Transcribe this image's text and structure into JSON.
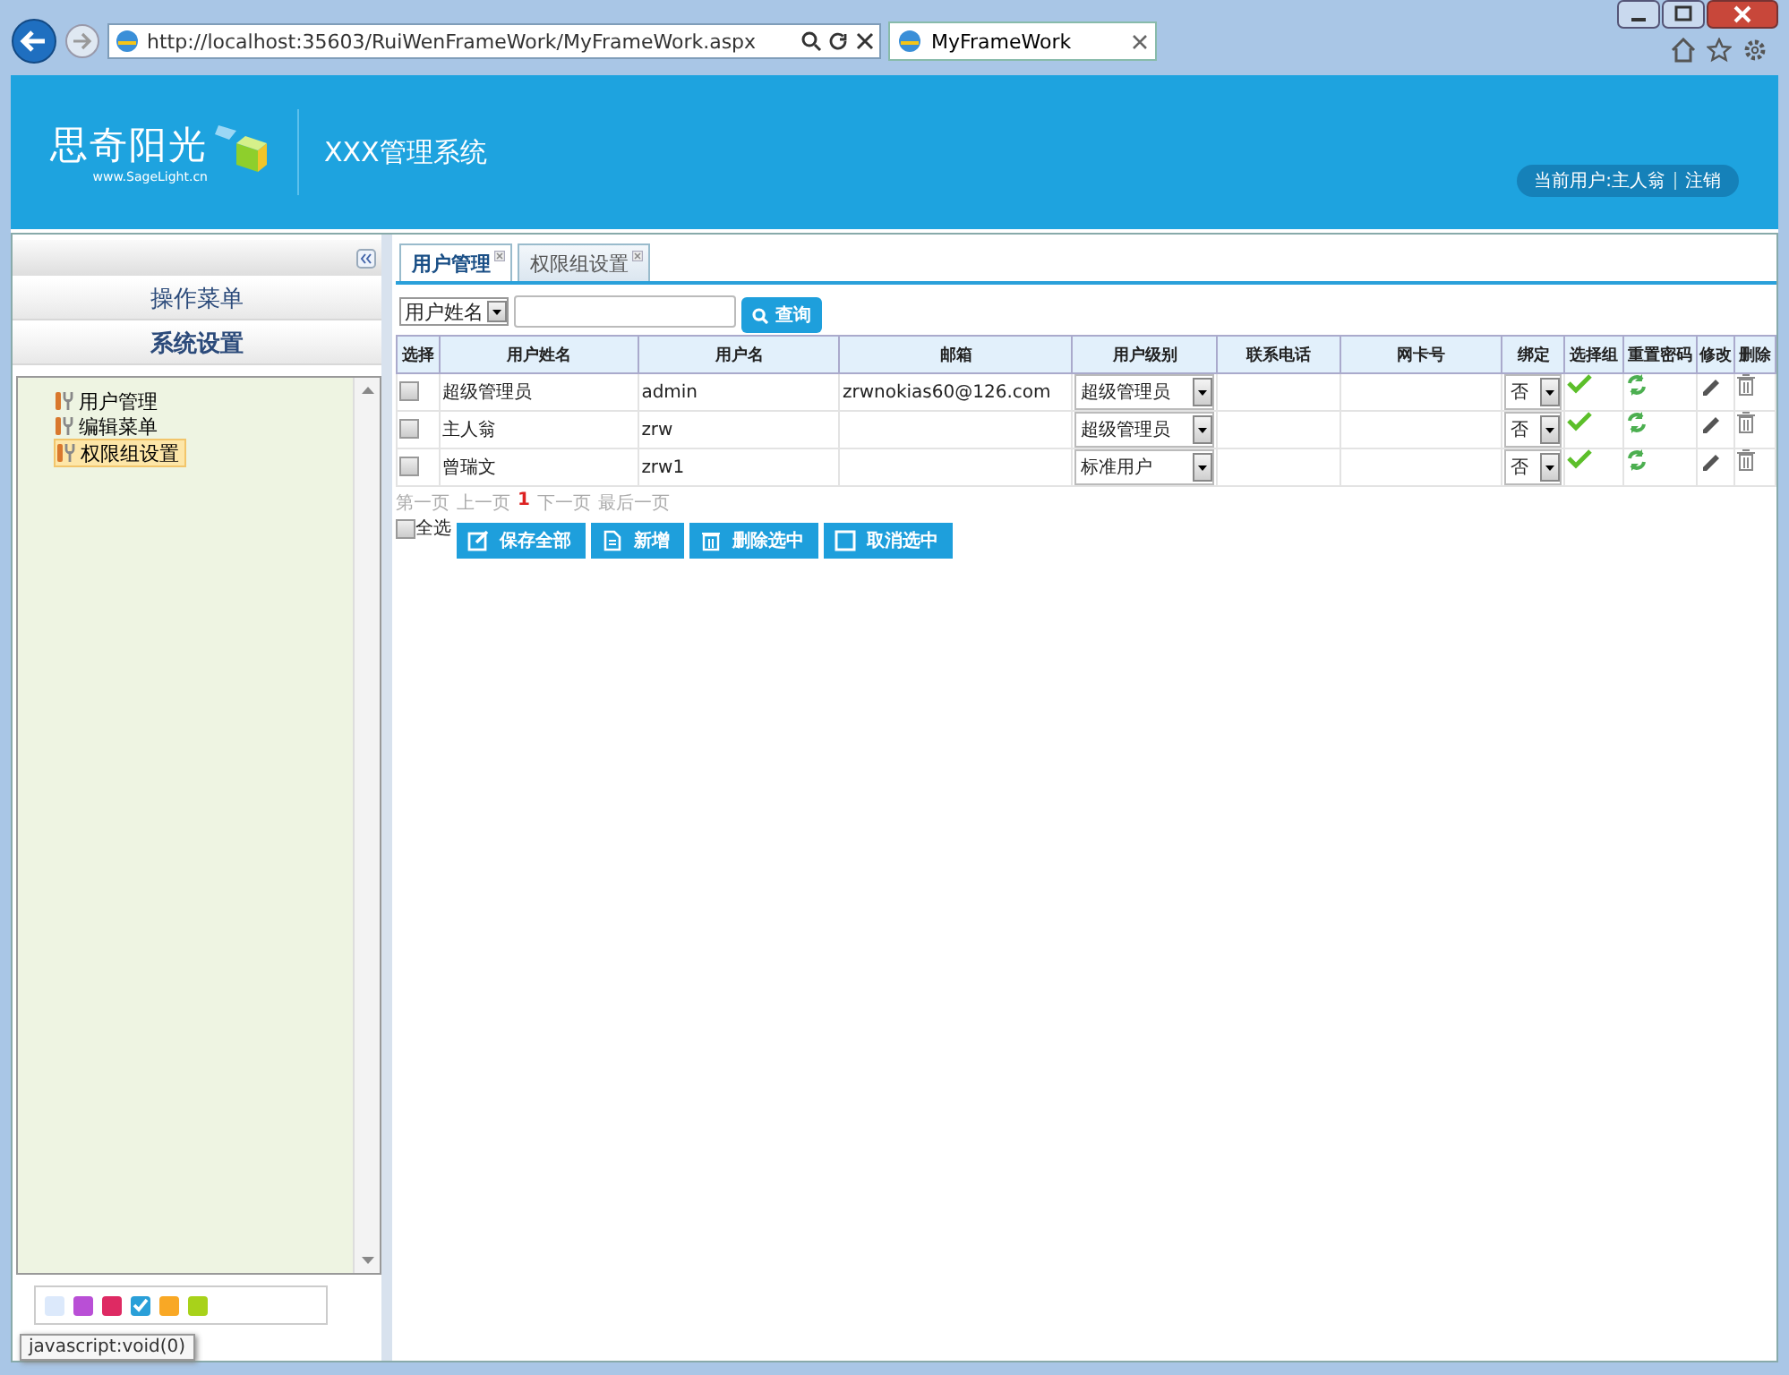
{
  "browser": {
    "address": "http://localhost:35603/RuiWenFrameWork/MyFrameWork.aspx",
    "tab": "MyFrameWork"
  },
  "header": {
    "logo_text": "思奇阳光",
    "logo_subtext": "www.SageLight.cn",
    "title": "XXX管理系统",
    "user_label": "当前用户:主人翁",
    "logout": "注销"
  },
  "sidebar": {
    "sections": [
      {
        "label": "操作菜单",
        "selected": false
      },
      {
        "label": "系统设置",
        "selected": true
      }
    ],
    "tree": [
      {
        "label": "用户管理",
        "selected": false
      },
      {
        "label": "编辑菜单",
        "selected": false
      },
      {
        "label": "权限组设置",
        "selected": true
      }
    ],
    "themes": [
      {
        "color": "#dce9fb",
        "selected": false
      },
      {
        "color": "#b94fd6",
        "selected": false
      },
      {
        "color": "#de2a63",
        "selected": false
      },
      {
        "color": "#2a9fd8",
        "selected": true
      },
      {
        "color": "#f9a825",
        "selected": false
      },
      {
        "color": "#a8d21a",
        "selected": false
      }
    ],
    "tooltip": "javascript:void(0)"
  },
  "main": {
    "tabs": [
      {
        "label": "用户管理",
        "selected": true
      },
      {
        "label": "权限组设置",
        "selected": false
      }
    ],
    "search": {
      "field": "用户姓名",
      "button": "查询"
    },
    "table": {
      "columns": [
        "选择",
        "用户姓名",
        "用户名",
        "邮箱",
        "用户级别",
        "联系电话",
        "网卡号",
        "绑定",
        "选择组",
        "重置密码",
        "修改",
        "删除"
      ],
      "rows": [
        {
          "checked": false,
          "name": "超级管理员",
          "username": "admin",
          "email": "zrwnokias60@126.com",
          "level": "超级管理员",
          "bound": "否"
        },
        {
          "checked": false,
          "name": "主人翁",
          "username": "zrw",
          "level": "超级管理员",
          "bound": "否"
        },
        {
          "checked": false,
          "name": "曾瑞文",
          "username": "zrw1",
          "level": "标准用户",
          "bound": "否"
        }
      ]
    },
    "pager": {
      "first": "第一页",
      "prev": "上一页",
      "current": "1",
      "next": "下一页",
      "last": "最后一页"
    },
    "select_all": {
      "label": "全选",
      "checked": false
    },
    "buttons": [
      {
        "kind": "save",
        "label": "保存全部"
      },
      {
        "kind": "add",
        "label": "新增"
      },
      {
        "kind": "delete",
        "label": "删除选中"
      },
      {
        "kind": "cancel",
        "label": "取消选中"
      }
    ]
  }
}
